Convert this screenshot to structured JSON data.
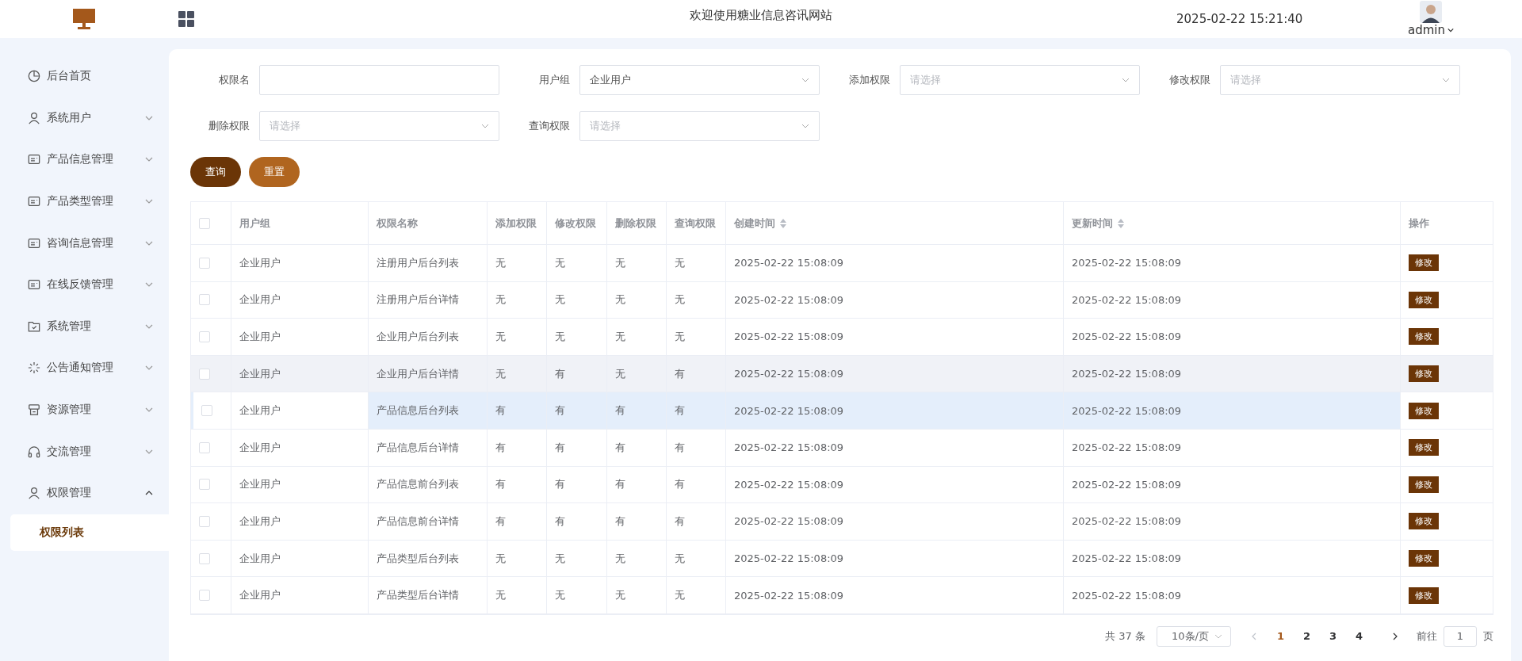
{
  "header": {
    "title": "欢迎使用糖业信息咨讯网站",
    "datetime": "2025-02-22 15:21:40",
    "user": "admin"
  },
  "sidebar": {
    "items": [
      {
        "label": "后台首页"
      },
      {
        "label": "系统用户",
        "expanded": false
      },
      {
        "label": "产品信息管理",
        "expanded": false
      },
      {
        "label": "产品类型管理",
        "expanded": false
      },
      {
        "label": "咨询信息管理",
        "expanded": false
      },
      {
        "label": "在线反馈管理",
        "expanded": false
      },
      {
        "label": "系统管理",
        "expanded": false
      },
      {
        "label": "公告通知管理",
        "expanded": false
      },
      {
        "label": "资源管理",
        "expanded": false
      },
      {
        "label": "交流管理",
        "expanded": false
      },
      {
        "label": "权限管理",
        "expanded": true,
        "children": [
          {
            "label": "权限列表",
            "selected": true
          }
        ]
      }
    ]
  },
  "filters": [
    {
      "label": "权限名",
      "kind": "text"
    },
    {
      "label": "用户组",
      "kind": "select",
      "value": "企业用户"
    },
    {
      "label": "添加权限",
      "kind": "select",
      "placeholder": "请选择"
    },
    {
      "label": "修改权限",
      "kind": "select",
      "placeholder": "请选择"
    },
    {
      "label": "删除权限",
      "kind": "select",
      "placeholder": "请选择"
    },
    {
      "label": "查询权限",
      "kind": "select",
      "placeholder": "请选择"
    }
  ],
  "buttons": [
    {
      "label": "查询",
      "kind": "primary"
    },
    {
      "label": "重置",
      "kind": "secondary"
    }
  ],
  "table": {
    "columns": [
      {
        "label": "用户组",
        "sortable": false
      },
      {
        "label": "权限名称",
        "sortable": false
      },
      {
        "label": "添加权限",
        "sortable": false
      },
      {
        "label": "修改权限",
        "sortable": false
      },
      {
        "label": "删除权限",
        "sortable": false
      },
      {
        "label": "查询权限",
        "sortable": false
      },
      {
        "label": "创建时间",
        "sortable": true
      },
      {
        "label": "更新时间",
        "sortable": true
      },
      {
        "label": "操作",
        "sortable": false
      }
    ],
    "all_checked": false,
    "rows": [
      {
        "checked": false,
        "shaded": false,
        "hovered": false,
        "cells": [
          "企业用户",
          "注册用户后台列表",
          "无",
          "无",
          "无",
          "无",
          "2025-02-22 15:08:09",
          "2025-02-22 15:08:09"
        ],
        "action": "修改"
      },
      {
        "checked": false,
        "shaded": false,
        "hovered": false,
        "cells": [
          "企业用户",
          "注册用户后台详情",
          "无",
          "无",
          "无",
          "无",
          "2025-02-22 15:08:09",
          "2025-02-22 15:08:09"
        ],
        "action": "修改"
      },
      {
        "checked": false,
        "shaded": false,
        "hovered": false,
        "cells": [
          "企业用户",
          "企业用户后台列表",
          "无",
          "无",
          "无",
          "无",
          "2025-02-22 15:08:09",
          "2025-02-22 15:08:09"
        ],
        "action": "修改"
      },
      {
        "checked": false,
        "shaded": true,
        "hovered": false,
        "cells": [
          "企业用户",
          "企业用户后台详情",
          "无",
          "有",
          "无",
          "有",
          "2025-02-22 15:08:09",
          "2025-02-22 15:08:09"
        ],
        "action": "修改"
      },
      {
        "checked": false,
        "shaded": false,
        "hovered": true,
        "cells": [
          "企业用户",
          "产品信息后台列表",
          "有",
          "有",
          "有",
          "有",
          "2025-02-22 15:08:09",
          "2025-02-22 15:08:09"
        ],
        "action": "修改"
      },
      {
        "checked": false,
        "shaded": false,
        "hovered": false,
        "cells": [
          "企业用户",
          "产品信息后台详情",
          "有",
          "有",
          "有",
          "有",
          "2025-02-22 15:08:09",
          "2025-02-22 15:08:09"
        ],
        "action": "修改"
      },
      {
        "checked": false,
        "shaded": false,
        "hovered": false,
        "cells": [
          "企业用户",
          "产品信息前台列表",
          "有",
          "有",
          "有",
          "有",
          "2025-02-22 15:08:09",
          "2025-02-22 15:08:09"
        ],
        "action": "修改"
      },
      {
        "checked": false,
        "shaded": false,
        "hovered": false,
        "cells": [
          "企业用户",
          "产品信息前台详情",
          "有",
          "有",
          "有",
          "有",
          "2025-02-22 15:08:09",
          "2025-02-22 15:08:09"
        ],
        "action": "修改"
      },
      {
        "checked": false,
        "shaded": false,
        "hovered": false,
        "cells": [
          "企业用户",
          "产品类型后台列表",
          "无",
          "无",
          "无",
          "无",
          "2025-02-22 15:08:09",
          "2025-02-22 15:08:09"
        ],
        "action": "修改"
      },
      {
        "checked": false,
        "shaded": false,
        "hovered": false,
        "cells": [
          "企业用户",
          "产品类型后台详情",
          "无",
          "无",
          "无",
          "无",
          "2025-02-22 15:08:09",
          "2025-02-22 15:08:09"
        ],
        "action": "修改"
      }
    ]
  },
  "pagination": {
    "total": "共 37 条",
    "page_size": "10条/页",
    "pages": [
      {
        "label": "1",
        "selected": true
      },
      {
        "label": "2",
        "selected": false
      },
      {
        "label": "3",
        "selected": false
      },
      {
        "label": "4",
        "selected": false
      }
    ],
    "goto_label": "前往",
    "goto_value": "1",
    "goto_suffix": "页"
  }
}
